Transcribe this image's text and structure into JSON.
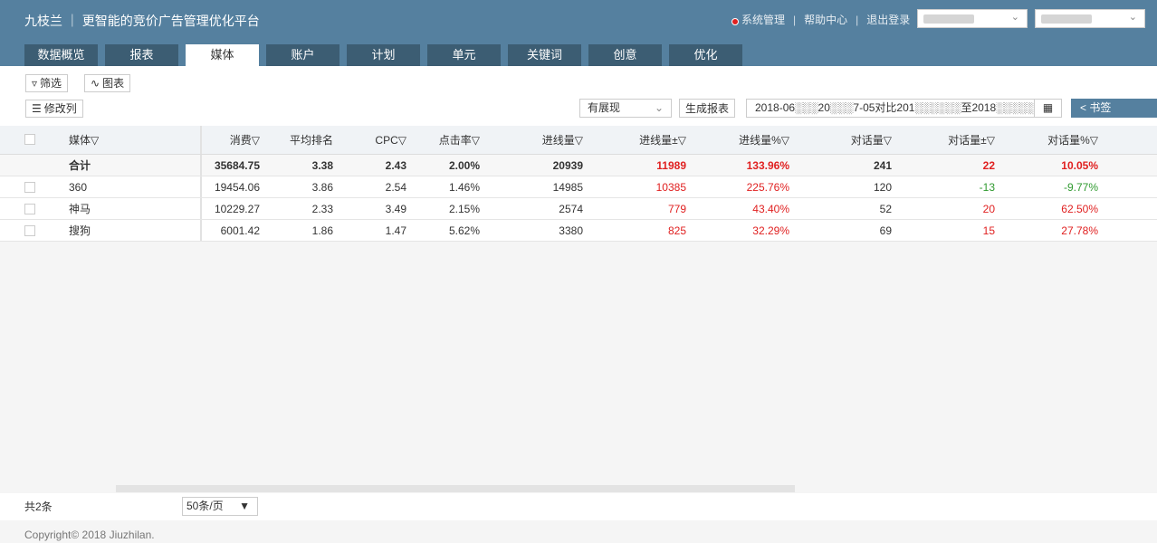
{
  "header": {
    "brand": "九枝兰 ｜ 更智能的竞价广告管理优化平台",
    "links": [
      "系统管理",
      "帮助中心",
      "退出登录"
    ]
  },
  "tabs": [
    {
      "label": "数据概览",
      "active": false
    },
    {
      "label": "报表",
      "active": false
    },
    {
      "label": "媒体",
      "active": true
    },
    {
      "label": "账户",
      "active": false
    },
    {
      "label": "计划",
      "active": false
    },
    {
      "label": "单元",
      "active": false
    },
    {
      "label": "关键词",
      "active": false
    },
    {
      "label": "创意",
      "active": false
    },
    {
      "label": "优化",
      "active": false
    }
  ],
  "toolbar": {
    "filter": "筛选",
    "chart": "图表",
    "edit_columns": "修改列",
    "display_mode": "有展现",
    "generate_report": "生成报表",
    "date_range": "2018-06░░░20░░░7-05对比201░░░░░░至2018░░░░░",
    "bookmark": "书签"
  },
  "table": {
    "columns": [
      "媒体",
      "消费",
      "平均排名",
      "CPC",
      "点击率",
      "进线量",
      "进线量±",
      "进线量%",
      "对话量",
      "对话量±",
      "对话量%"
    ],
    "total": {
      "name": "合计",
      "cells": [
        "35684.75",
        "3.38",
        "2.43",
        "2.00%",
        "20939",
        "11989",
        "133.96%",
        "241",
        "22",
        "10.05%"
      ]
    },
    "rows": [
      {
        "name": "360",
        "cells": [
          "19454.06",
          "3.86",
          "2.54",
          "1.46%",
          "14985",
          "10385",
          "225.76%",
          "120",
          "-13",
          "-9.77%"
        ]
      },
      {
        "name": "神马",
        "cells": [
          "10229.27",
          "2.33",
          "3.49",
          "2.15%",
          "2574",
          "779",
          "43.40%",
          "52",
          "20",
          "62.50%"
        ]
      },
      {
        "name": "搜狗",
        "cells": [
          "6001.42",
          "1.86",
          "1.47",
          "5.62%",
          "3380",
          "825",
          "32.29%",
          "69",
          "15",
          "27.78%"
        ]
      }
    ]
  },
  "footer": {
    "count": "共2条",
    "page_size": "50条/页",
    "copyright": "Copyright© 2018 Jiuzhilan."
  },
  "colors": {
    "header": "#55809f",
    "tab": "#3c5d73",
    "positive": "#e02020",
    "negative": "#2f9a2f"
  }
}
